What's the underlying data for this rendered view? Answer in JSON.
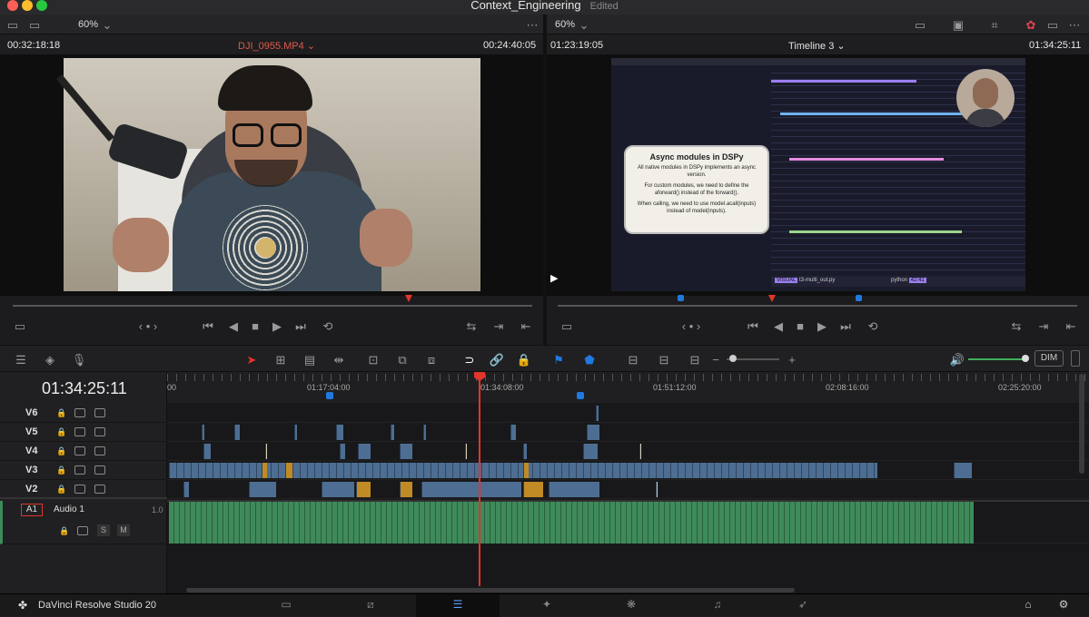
{
  "window": {
    "title": "Context_Engineering",
    "status": "Edited"
  },
  "source_viewer": {
    "zoom": "60%",
    "timecode_in": "00:32:18:18",
    "clip_name": "DJI_0955.MP4",
    "timecode_out": "00:24:40:05"
  },
  "program_viewer": {
    "zoom": "60%",
    "timecode": "01:23:19:05",
    "timeline_name": "Timeline 3",
    "timecode_out": "01:34:25:11",
    "overlay_title": "Async modules in DSPy",
    "overlay_text": [
      "All native modules in DSPy implements an async version.",
      "For custom modules, we need to define the aforward() instead of the forward().",
      "When calling, we need to use model.acall(inputs) instead of model(inputs)."
    ],
    "editor_status": "VISUAL",
    "editor_file": "t3-multi_out.py",
    "editor_lang": "python",
    "editor_pos": "42:41"
  },
  "timeline": {
    "current_timecode": "01:34:25:11",
    "ruler_ticks": [
      "00",
      "01:17:04:00",
      "01:34:08:00",
      "01:51:12:00",
      "02:08:16:00",
      "02:25:20:00"
    ],
    "playhead_fraction": 0.337,
    "video_tracks": [
      "V6",
      "V5",
      "V4",
      "V3",
      "V2"
    ],
    "audio_track": {
      "id": "A1",
      "name": "Audio 1",
      "level": "1.0",
      "solo": "S",
      "mute": "M"
    },
    "dim_label": "DIM"
  },
  "bottom_bar": {
    "app_name": "DaVinci Resolve Studio 20"
  },
  "icons": [
    "media-icon",
    "cut-icon",
    "edit-icon",
    "fusion-icon",
    "color-icon",
    "fairlight-icon",
    "deliver-icon",
    "home-icon",
    "settings-icon"
  ],
  "colors": {
    "playhead": "#e2352b",
    "video_clip": "#4d6e92",
    "audio_clip": "#3f8a5a",
    "marker": "#1f7ae0"
  }
}
